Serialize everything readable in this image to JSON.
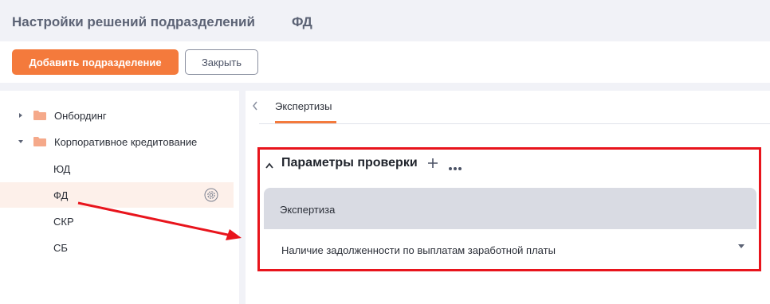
{
  "header": {
    "title": "Настройки решений подразделений",
    "subtitle": "ФД"
  },
  "toolbar": {
    "add_label": "Добавить подразделение",
    "close_label": "Закрыть"
  },
  "sidebar": {
    "items": [
      {
        "label": "Онбординг",
        "type": "folder",
        "expanded": false
      },
      {
        "label": "Корпоративное кредитование",
        "type": "folder",
        "expanded": true
      },
      {
        "label": "ЮД",
        "type": "leaf"
      },
      {
        "label": "ФД",
        "type": "leaf",
        "selected": true
      },
      {
        "label": "СКР",
        "type": "leaf"
      },
      {
        "label": "СБ",
        "type": "leaf"
      }
    ]
  },
  "tabs": [
    {
      "label": "Экспертизы",
      "active": true
    }
  ],
  "section": {
    "title": "Параметры проверки",
    "column_header": "Экспертиза",
    "rows": [
      {
        "value": "Наличие задолженности по выплатам заработной платы"
      }
    ]
  },
  "colors": {
    "accent": "#f47a3c",
    "annotation": "#e8141c",
    "selected_bg": "#fdf0ea",
    "folder": "#f5a98a"
  }
}
